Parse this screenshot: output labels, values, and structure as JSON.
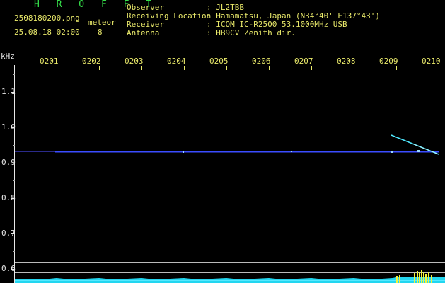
{
  "header": {
    "app_name": "H R O F F T",
    "filename": "2508180200.png",
    "timestamp": "25.08.18 02:00",
    "event_label": "meteor",
    "event_count": "8",
    "info": [
      {
        "label": "Observer",
        "value": ": JL2TBB"
      },
      {
        "label": "Receiving Location",
        "value": ": Hamamatsu, Japan (N34°40' E137°43')"
      },
      {
        "label": "Receiver",
        "value": ": ICOM IC-R2500 53.1000MHz USB"
      },
      {
        "label": "Antenna",
        "value": ": HB9CV Zenith dir."
      }
    ]
  },
  "axis": {
    "y_unit": "kHz",
    "y_ticks": [
      "1.1",
      "1.0",
      "0.9",
      "0.8",
      "0.7",
      "0.6"
    ],
    "x_ticks": [
      "0201",
      "0202",
      "0203",
      "0204",
      "0205",
      "0206",
      "0207",
      "0208",
      "0209",
      "0210"
    ]
  },
  "colors": {
    "label_yellow": "#e8e86a",
    "title_green": "#35e04a",
    "axis_white": "#e8e8e8",
    "carrier_blue": "#3a4cff",
    "meteor_cyan": "#4fe8ff",
    "noise_cyan": "#22d6f0",
    "burst_yellow": "#f2f23a"
  }
}
